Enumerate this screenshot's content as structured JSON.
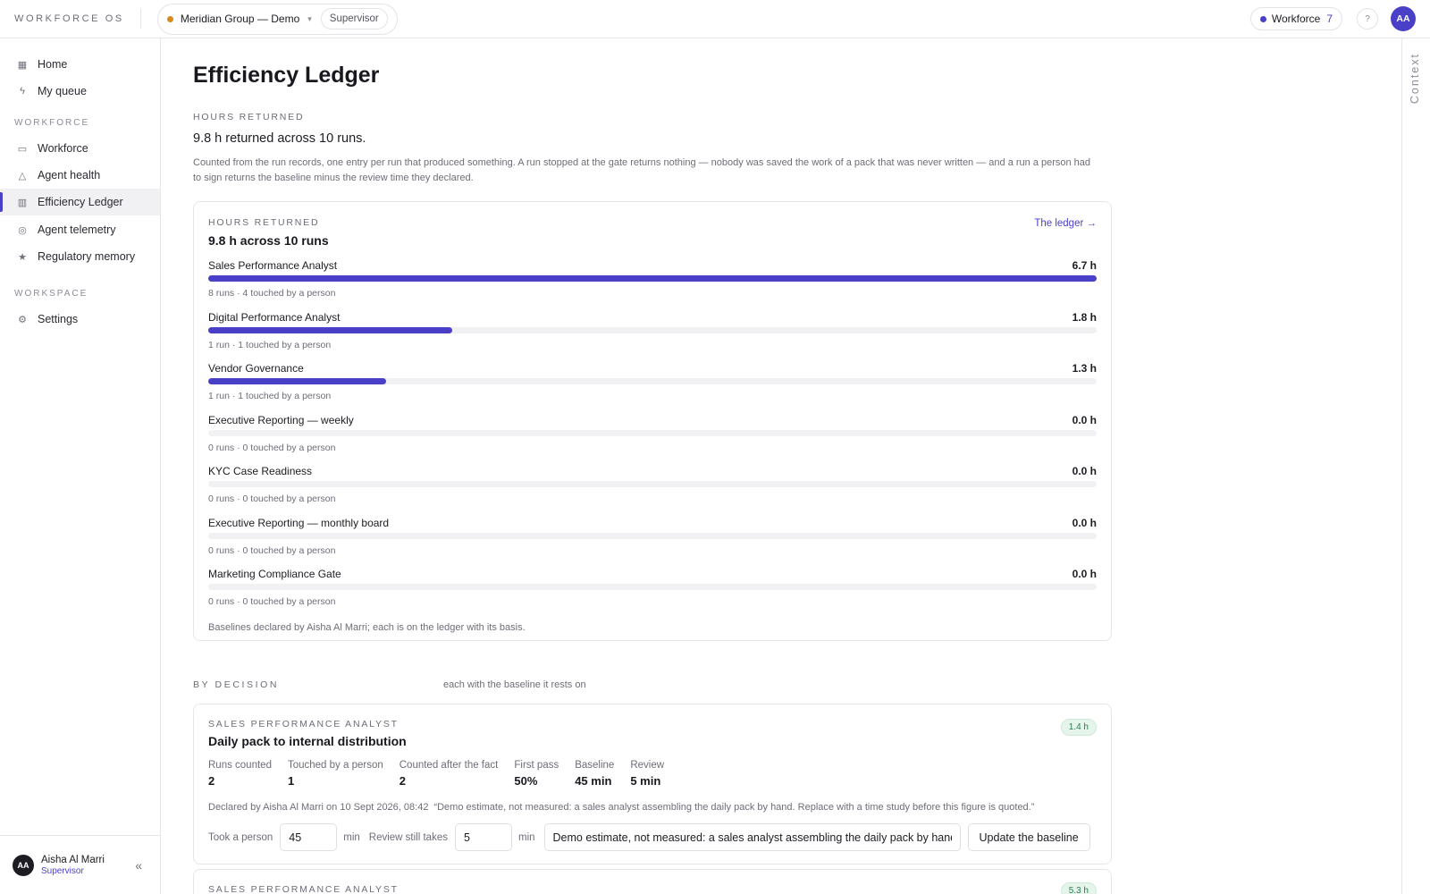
{
  "topbar": {
    "brand": "WORKFORCE OS",
    "org_name": "Meridian Group — Demo",
    "org_caret": "▾",
    "role": "Supervisor",
    "workforce_label": "Workforce",
    "workforce_count": "7",
    "help_icon": "?",
    "avatar_initials": "AA"
  },
  "sidebar": {
    "items_top": [
      {
        "label": "Home",
        "icon": "grid-icon"
      },
      {
        "label": "My queue",
        "icon": "bolt-icon"
      }
    ],
    "section_workforce": "WORKFORCE",
    "items_workforce": [
      {
        "label": "Workforce",
        "icon": "briefcase-icon"
      },
      {
        "label": "Agent health",
        "icon": "warning-icon"
      },
      {
        "label": "Efficiency Ledger",
        "icon": "bar-chart-icon",
        "active": true
      },
      {
        "label": "Agent telemetry",
        "icon": "target-icon"
      },
      {
        "label": "Regulatory memory",
        "icon": "star-icon"
      }
    ],
    "section_workspace": "WORKSPACE",
    "items_workspace": [
      {
        "label": "Settings",
        "icon": "gear-icon"
      }
    ],
    "user": {
      "initials": "AA",
      "name": "Aisha Al Marri",
      "role": "Supervisor",
      "collapse": "«"
    }
  },
  "context_rail": {
    "label": "Context"
  },
  "main": {
    "title": "Efficiency Ledger",
    "hours_eyebrow": "HOURS RETURNED",
    "hours_summary": "9.8 h returned across 10 runs.",
    "hours_description": "Counted from the run records, one entry per run that produced something. A run stopped at the gate returns nothing — nobody was saved the work of a pack that was never written — and a run a person had to sign returns the baseline minus the review time they declared.",
    "ledger": {
      "eyebrow": "HOURS RETURNED",
      "headline": "9.8 h across 10 runs",
      "link": "The ledger →",
      "rows": [
        {
          "name": "Sales Performance Analyst",
          "value": "6.7 h",
          "fraction": 1.0,
          "sub": "8 runs · 4 touched by a person"
        },
        {
          "name": "Digital Performance Analyst",
          "value": "1.8 h",
          "fraction": 0.275,
          "sub": "1 run · 1 touched by a person"
        },
        {
          "name": "Vendor Governance",
          "value": "1.3 h",
          "fraction": 0.2,
          "sub": "1 run · 1 touched by a person"
        },
        {
          "name": "Executive Reporting — weekly",
          "value": "0.0 h",
          "fraction": 0,
          "sub": "0 runs · 0 touched by a person"
        },
        {
          "name": "KYC Case Readiness",
          "value": "0.0 h",
          "fraction": 0,
          "sub": "0 runs · 0 touched by a person"
        },
        {
          "name": "Executive Reporting — monthly board",
          "value": "0.0 h",
          "fraction": 0,
          "sub": "0 runs · 0 touched by a person"
        },
        {
          "name": "Marketing Compliance Gate",
          "value": "0.0 h",
          "fraction": 0,
          "sub": "0 runs · 0 touched by a person"
        }
      ],
      "footnote": "Baselines declared by Aisha Al Marri; each is on the ledger with its basis."
    },
    "by_decision": {
      "eyebrow": "BY DECISION",
      "sub": "each with the baseline it rests on",
      "cards": [
        {
          "agent": "SALES PERFORMANCE ANALYST",
          "title": "Daily pack to internal distribution",
          "badge": "1.4 h",
          "metrics": [
            {
              "label": "Runs counted",
              "value": "2"
            },
            {
              "label": "Touched by a person",
              "value": "1"
            },
            {
              "label": "Counted after the fact",
              "value": "2"
            },
            {
              "label": "First pass",
              "value": "50%"
            },
            {
              "label": "Baseline",
              "value": "45 min"
            },
            {
              "label": "Review",
              "value": "5 min"
            }
          ],
          "declared": "Declared by Aisha Al Marri on 10 Sept 2026, 08:42",
          "quote": "“Demo estimate, not measured: a sales analyst assembling the daily pack by hand. Replace with a time study before this figure is quoted.”",
          "took_label": "Took a person",
          "took_value": "45",
          "unit": "min",
          "review_label": "Review still takes",
          "review_value": "5",
          "basis_value": "Demo estimate, not measured: a sales analyst assembling the daily pack by hand. Replace with a time study before this figure is quoted.",
          "button": "Update the baseline"
        },
        {
          "agent": "SALES PERFORMANCE ANALYST",
          "badge": "5.3 h"
        }
      ]
    }
  }
}
